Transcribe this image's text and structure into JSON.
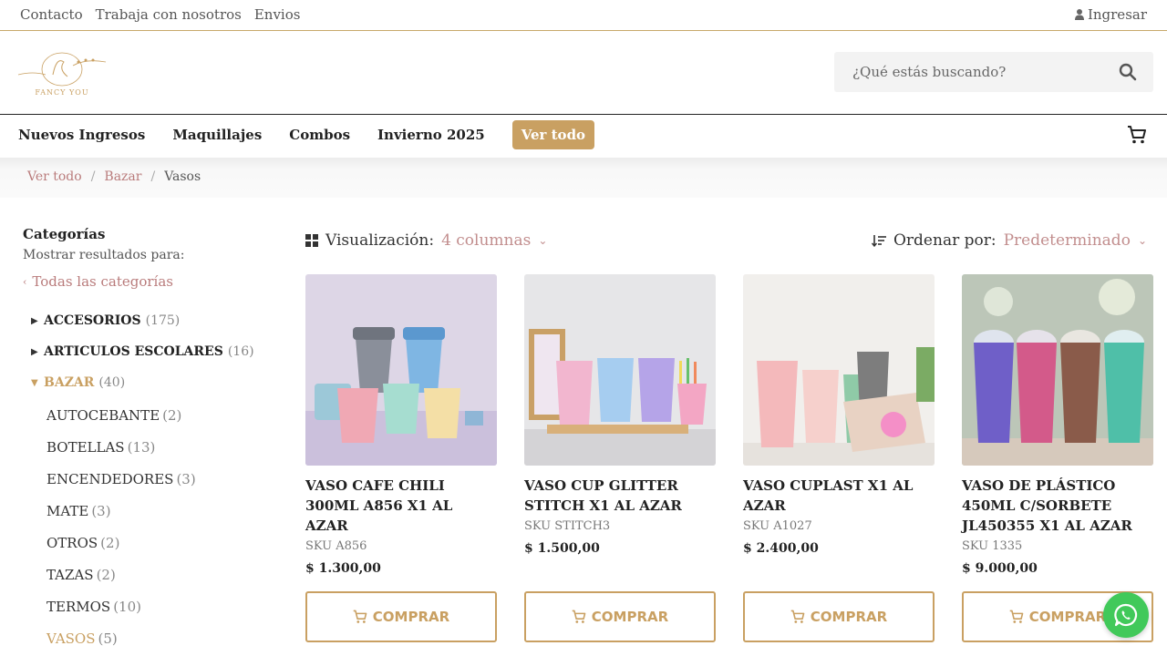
{
  "topbar": {
    "links": [
      "Contacto",
      "Trabaja con nosotros",
      "Envios"
    ],
    "login_label": "Ingresar"
  },
  "header": {
    "logo_text": "FANCY YOU",
    "search_placeholder": "¿Qué estás buscando?"
  },
  "nav": {
    "items": [
      "Nuevos Ingresos",
      "Maquillajes",
      "Combos",
      "Invierno 2025"
    ],
    "cta_label": "Ver todo"
  },
  "breadcrumb": {
    "items": [
      "Ver todo",
      "Bazar"
    ],
    "current": "Vasos"
  },
  "sidebar": {
    "title": "Categorías",
    "subtitle": "Mostrar resultados para:",
    "all_label": "Todas las categorías",
    "categories": [
      {
        "name": "ACCESORIOS",
        "count": "(175)"
      },
      {
        "name": "ARTICULOS ESCOLARES",
        "count": "(16)"
      },
      {
        "name": "BAZAR",
        "count": "(40)"
      }
    ],
    "subcategories": [
      {
        "name": "AUTOCEBANTE",
        "count": "(2)"
      },
      {
        "name": "BOTELLAS",
        "count": "(13)"
      },
      {
        "name": "ENCENDEDORES",
        "count": "(3)"
      },
      {
        "name": "MATE",
        "count": "(3)"
      },
      {
        "name": "OTROS",
        "count": "(2)"
      },
      {
        "name": "TAZAS",
        "count": "(2)"
      },
      {
        "name": "TERMOS",
        "count": "(10)"
      },
      {
        "name": "VASOS",
        "count": "(5)"
      }
    ]
  },
  "toolbar": {
    "view_label": "Visualización:",
    "view_value": "4 columnas",
    "sort_label": "Ordenar por:",
    "sort_value": "Predeterminado"
  },
  "products": [
    {
      "name": "VASO CAFE CHILI 300ML A856 X1 AL AZAR",
      "sku": "SKU A856",
      "price": "$  1.300,00",
      "buy_label": "COMPRAR"
    },
    {
      "name": "VASO CUP GLITTER STITCH X1 AL AZAR",
      "sku": "SKU STITCH3",
      "price": "$  1.500,00",
      "buy_label": "COMPRAR"
    },
    {
      "name": "VASO CUPLAST X1 AL AZAR",
      "sku": "SKU A1027",
      "price": "$  2.400,00",
      "buy_label": "COMPRAR"
    },
    {
      "name": "VASO DE PLÁSTICO 450ML C/SORBETE JL450355 X1 AL AZAR",
      "sku": "SKU 1335",
      "price": "$  9.000,00",
      "buy_label": "COMPRAR"
    }
  ],
  "colors": {
    "accent": "#c9a062",
    "link": "#b97b7b",
    "whatsapp": "#41c95a"
  }
}
